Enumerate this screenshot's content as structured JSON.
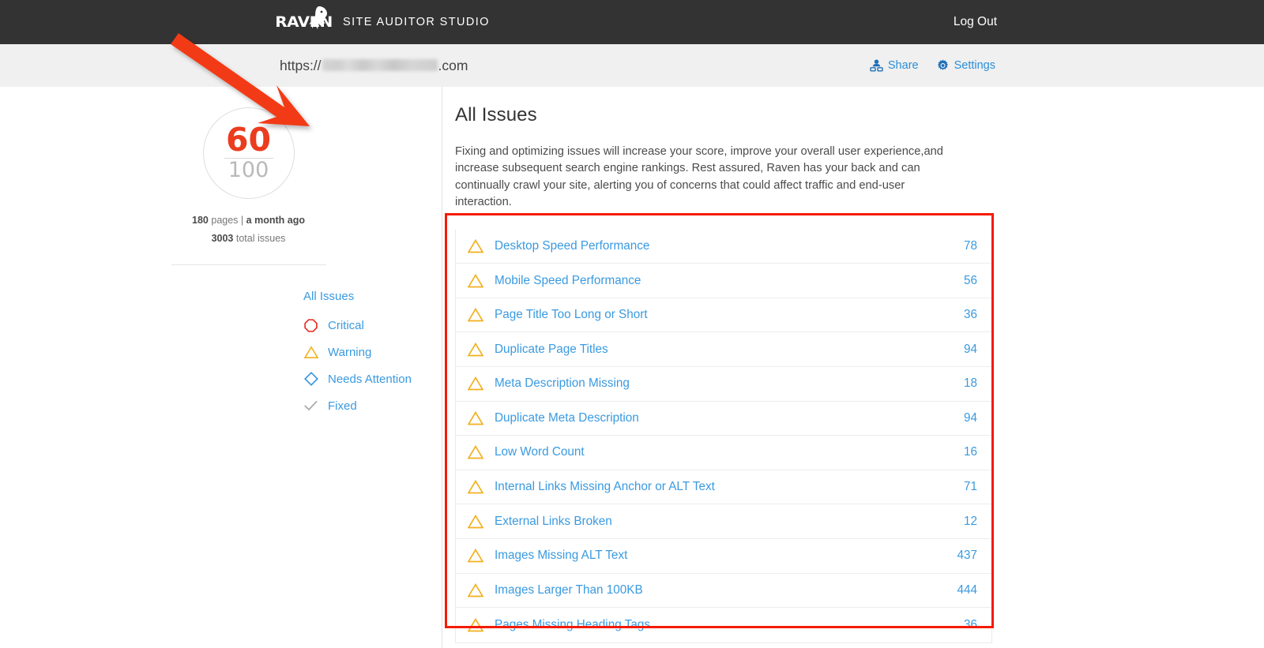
{
  "topbar": {
    "logo_word": "RAVEN",
    "logo_icon": "raven-bird-icon",
    "brand_title": "SITE AUDITOR STUDIO",
    "logout_label": "Log Out",
    "background_color": "#333333"
  },
  "subbar": {
    "url_prefix": "https://",
    "url_redacted": true,
    "url_suffix": ".com",
    "actions": [
      {
        "label": "Share",
        "icon": "share-person-icon"
      },
      {
        "label": "Settings",
        "icon": "gear-icon"
      }
    ],
    "accent_color": "#2b8fd8",
    "background_color": "#f0f0f0"
  },
  "sidebar": {
    "score": {
      "value": "60",
      "max": "100",
      "value_color": "#eb3c1e",
      "max_color": "#b9b9b9"
    },
    "meta": {
      "pages_count": "180",
      "pages_label": "pages",
      "separator": "|",
      "crawl_time": "a month ago",
      "issues_count": "3003",
      "issues_label": "total issues"
    },
    "filters": [
      {
        "label": "All Issues",
        "icon": "none",
        "icon_color": ""
      },
      {
        "label": "Critical",
        "icon": "octagon-icon",
        "icon_color": "#e8261c"
      },
      {
        "label": "Warning",
        "icon": "triangle-icon",
        "icon_color": "#f2b01e"
      },
      {
        "label": "Needs Attention",
        "icon": "diamond-icon",
        "icon_color": "#3a9ae0"
      },
      {
        "label": "Fixed",
        "icon": "check-icon",
        "icon_color": "#a8a8a8"
      }
    ]
  },
  "main": {
    "title": "All Issues",
    "description": "Fixing and optimizing issues will increase your score, improve your overall user experience,and increase subsequent search engine rankings. Rest assured, Raven has your back and can continually crawl your site, alerting you of concerns that could affect traffic and end-user interaction.",
    "link_color": "#3a9ae0",
    "issues": [
      {
        "icon": "triangle-icon",
        "severity": "warning",
        "name": "Desktop Speed Performance",
        "count": "78"
      },
      {
        "icon": "triangle-icon",
        "severity": "warning",
        "name": "Mobile Speed Performance",
        "count": "56"
      },
      {
        "icon": "triangle-icon",
        "severity": "warning",
        "name": "Page Title Too Long or Short",
        "count": "36"
      },
      {
        "icon": "triangle-icon",
        "severity": "warning",
        "name": "Duplicate Page Titles",
        "count": "94"
      },
      {
        "icon": "triangle-icon",
        "severity": "warning",
        "name": "Meta Description Missing",
        "count": "18"
      },
      {
        "icon": "triangle-icon",
        "severity": "warning",
        "name": "Duplicate Meta Description",
        "count": "94"
      },
      {
        "icon": "triangle-icon",
        "severity": "warning",
        "name": "Low Word Count",
        "count": "16"
      },
      {
        "icon": "triangle-icon",
        "severity": "warning",
        "name": "Internal Links Missing Anchor or ALT Text",
        "count": "71"
      },
      {
        "icon": "triangle-icon",
        "severity": "warning",
        "name": "External Links Broken",
        "count": "12"
      },
      {
        "icon": "triangle-icon",
        "severity": "warning",
        "name": "Images Missing ALT Text",
        "count": "437"
      },
      {
        "icon": "triangle-icon",
        "severity": "warning",
        "name": "Images Larger Than 100KB",
        "count": "444"
      },
      {
        "icon": "triangle-icon",
        "severity": "warning",
        "name": "Pages Missing Heading Tags",
        "count": "36"
      }
    ]
  },
  "annotations": {
    "box_color": "#f51b00",
    "arrow_color": "#f23a18"
  }
}
